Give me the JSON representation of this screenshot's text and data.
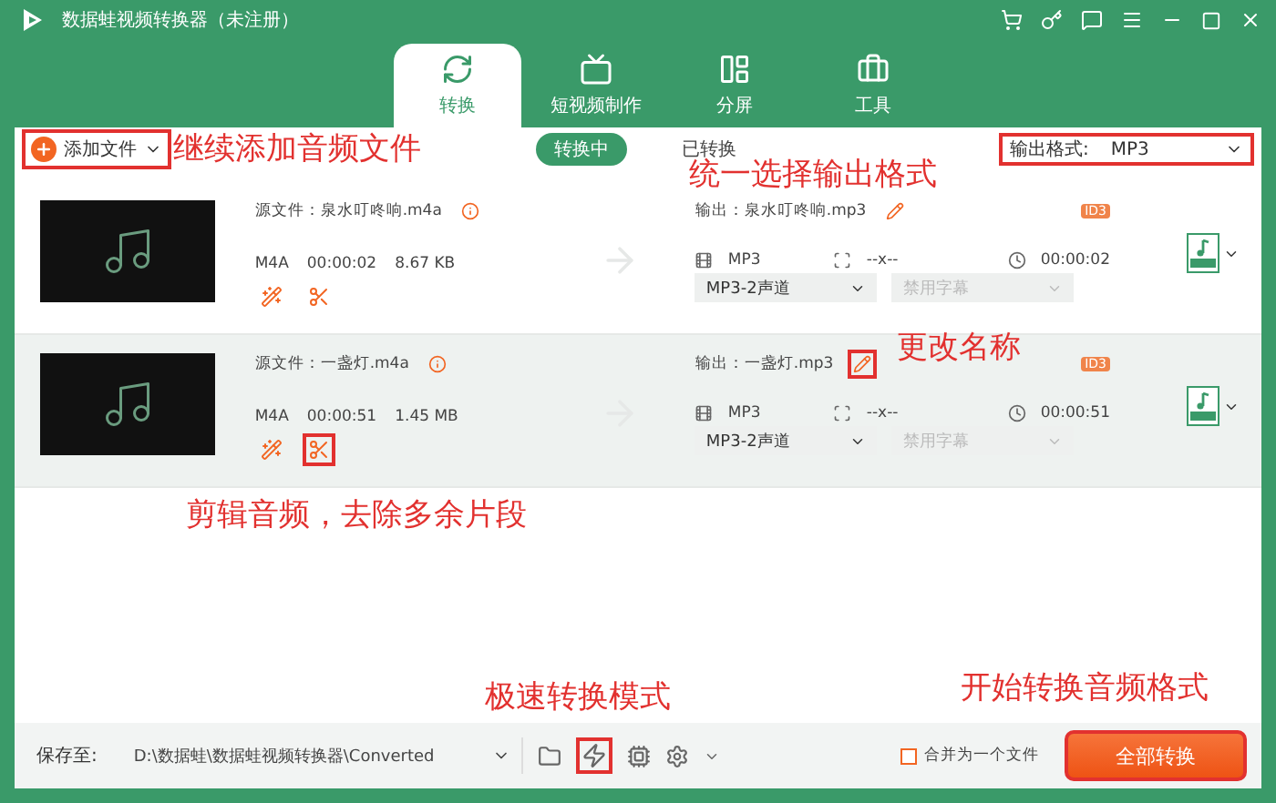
{
  "window": {
    "title": "数据蛙视频转换器（未注册）"
  },
  "tabs": [
    {
      "label": "转换",
      "kind": "convert",
      "selected": true
    },
    {
      "label": "短视频制作",
      "kind": "video",
      "selected": false
    },
    {
      "label": "分屏",
      "kind": "split",
      "selected": false
    },
    {
      "label": "工具",
      "kind": "tools",
      "selected": false
    }
  ],
  "toolbar": {
    "add_button": {
      "label": "添加文件",
      "highlighted": true
    },
    "filters": [
      {
        "label": "转换中",
        "selected": true
      },
      {
        "label": "已转换",
        "selected": false
      }
    ],
    "output_format": {
      "label": "输出格式:",
      "value": "MP3",
      "highlighted": true
    }
  },
  "files": [
    {
      "source": "源文件：泉水叮咚响.m4a",
      "type": "M4A",
      "length": "00:00:02",
      "size": "8.67 KB",
      "output": "输出：泉水叮咚响.mp3",
      "badge": "ID3",
      "format": "MP3",
      "resolution": "--x--",
      "duration": "00:00:02",
      "audio": "MP3-2声道",
      "subtitle": "禁用字幕",
      "selected": false,
      "rename_highlighted": false,
      "cut_highlighted": false
    },
    {
      "source": "源文件：一盏灯.m4a",
      "type": "M4A",
      "length": "00:00:51",
      "size": "1.45 MB",
      "output": "输出：一盏灯.mp3",
      "badge": "ID3",
      "format": "MP3",
      "resolution": "--x--",
      "duration": "00:00:51",
      "audio": "MP3-2声道",
      "subtitle": "禁用字幕",
      "selected": true,
      "rename_highlighted": true,
      "cut_highlighted": true
    }
  ],
  "bottom_bar": {
    "save_label": "保存至:",
    "path": "D:\\数据蛙\\数据蛙视频转换器\\Converted",
    "speed_highlighted": true,
    "merge": {
      "label": "合并为一个文件",
      "checked": false
    },
    "convert_button": {
      "label": "全部转换",
      "highlighted": true
    }
  },
  "annotations": [
    {
      "text": "继续添加音频文件"
    },
    {
      "text": "统一选择输出格式"
    },
    {
      "text": "更改名称"
    },
    {
      "text": "剪辑音频，去除多余片段"
    },
    {
      "text": "极速转换模式"
    },
    {
      "text": "开始转换音频格式"
    }
  ]
}
